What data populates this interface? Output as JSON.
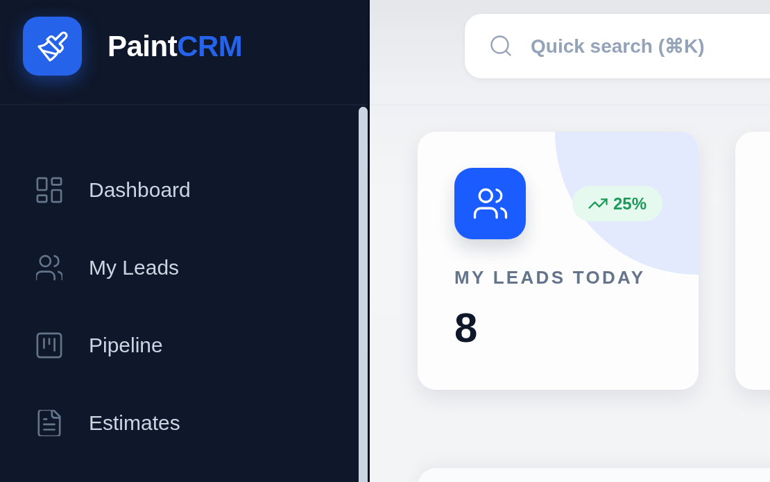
{
  "brand": {
    "name": "Paint",
    "accent": "CRM"
  },
  "sidebar": {
    "items": [
      {
        "label": "Dashboard"
      },
      {
        "label": "My Leads"
      },
      {
        "label": "Pipeline"
      },
      {
        "label": "Estimates"
      }
    ]
  },
  "search": {
    "placeholder": "Quick search (⌘K)"
  },
  "stat_cards": [
    {
      "label": "MY LEADS TODAY",
      "value": "8",
      "change": "25%",
      "increase": true
    }
  ]
}
